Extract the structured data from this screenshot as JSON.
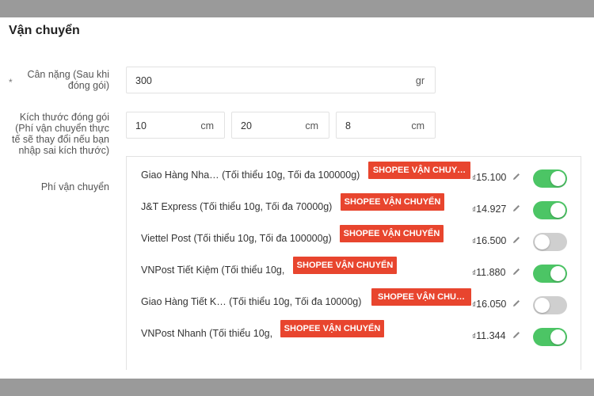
{
  "section": {
    "title": "Vận chuyển"
  },
  "weight": {
    "star": "*",
    "label_line1": "Cân nặng (Sau khi",
    "label_line2": "đóng gói)",
    "value": "300",
    "unit": "gr"
  },
  "dimensions": {
    "label_lines": [
      "Kích thước đóng gói",
      "(Phí vận chuyển thực",
      "tế sẽ thay đổi nếu bạn",
      "nhập sai kích thước)"
    ],
    "fields": [
      {
        "value": "10",
        "unit": "cm"
      },
      {
        "value": "20",
        "unit": "cm"
      },
      {
        "value": "8",
        "unit": "cm"
      }
    ]
  },
  "shipping_fee": {
    "label": "Phí vận chuyển",
    "currency_symbol": "₫",
    "carriers": [
      {
        "name": "Giao Hàng Nha…  (Tối thiểu 10g, Tối đa 100000g)",
        "tag": "SHOPEE VẬN CHUY…",
        "price": "15.100",
        "enabled": true
      },
      {
        "name": "J&T Express  (Tối thiểu 10g, Tối đa 70000g)",
        "tag": "SHOPEE VẬN CHUYỂN",
        "price": "14.927",
        "enabled": true
      },
      {
        "name": "Viettel Post  (Tối thiểu 10g, Tối đa 100000g)",
        "tag": "SHOPEE VẬN CHUYỂN",
        "price": "16.500",
        "enabled": false
      },
      {
        "name": "VNPost Tiết Kiệm  (Tối thiểu 10g,",
        "tag": "SHOPEE VẬN CHUYỂN",
        "price": "11.880",
        "enabled": true
      },
      {
        "name": "Giao Hàng Tiết K…  (Tối thiểu 10g, Tối đa 10000g)",
        "tag": "SHOPEE VẬN CHU…",
        "price": "16.050",
        "enabled": false
      },
      {
        "name": "VNPost Nhanh  (Tối thiểu 10g,",
        "tag": "SHOPEE VẬN CHUYỂN",
        "price": "11.344",
        "enabled": true
      }
    ]
  },
  "colors": {
    "tag_bg": "#e8452e",
    "toggle_on": "#4cc565",
    "toggle_off": "#cfcfcf"
  },
  "icons": {
    "edit": "pencil-icon"
  }
}
